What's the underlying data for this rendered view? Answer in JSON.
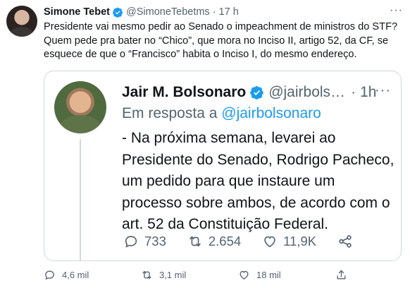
{
  "tweet": {
    "author_name": "Simone Tebet",
    "author_handle": "@SimoneTebetms",
    "separator": "·",
    "time": "17 h",
    "more": "···",
    "text": "Presidente vai mesmo pedir ao Senado o impeachment de ministros do STF? Quem pede  pra bater no “Chico”, que mora no Inciso II, artigo 52, da CF, se esquece de que o “Francisco” habita o Inciso I, do mesmo endereço.",
    "actions": {
      "replies": "4,6 mil",
      "retweets": "3,1 mil",
      "likes": "18 mil"
    }
  },
  "quoted": {
    "author_name": "Jair M. Bolsonaro",
    "author_handle": "@jairbols…",
    "separator": "·",
    "time": "1h",
    "more": "···",
    "reply_prefix": "Em resposta a",
    "reply_mention": "@jairbolsonaro",
    "text": "- Na próxima semana, levarei ao Presidente do Senado, Rodrigo Pacheco, um pedido para que instaure um processo sobre ambos, de acordo com o art. 52 da Constituição Federal.",
    "actions": {
      "replies": "733",
      "retweets": "2.654",
      "likes": "11,9K"
    }
  },
  "colors": {
    "accent": "#1d9bf0",
    "text": "#0f1419",
    "muted": "#536471",
    "border": "#cfd9de"
  },
  "icons": [
    "verified-badge-icon",
    "more-icon",
    "reply-icon",
    "retweet-icon",
    "like-icon",
    "share-icon"
  ]
}
